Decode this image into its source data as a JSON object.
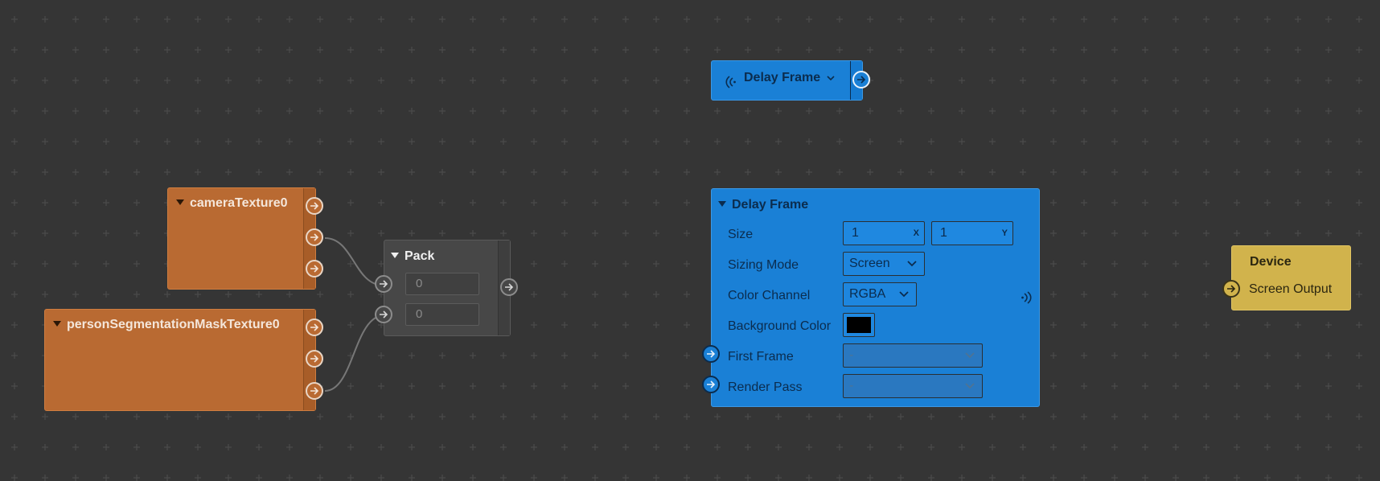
{
  "nodes": {
    "camera_texture": {
      "title": "cameraTexture0"
    },
    "person_mask": {
      "title": "personSegmentationMaskTexture0"
    },
    "pack": {
      "title": "Pack",
      "field_1": "0",
      "field_2": "0"
    },
    "delay_collapsed": {
      "title": "Delay Frame"
    },
    "delay_frame": {
      "title": "Delay Frame",
      "size_label": "Size",
      "size_x": "1",
      "size_x_axis": "X",
      "size_y": "1",
      "size_y_axis": "Y",
      "sizing_mode_label": "Sizing Mode",
      "sizing_mode_value": "Screen",
      "color_channel_label": "Color Channel",
      "color_channel_value": "RGBA",
      "background_color_label": "Background Color",
      "background_color_value": "#000000",
      "first_frame_label": "First Frame",
      "first_frame_value": "-",
      "render_pass_label": "Render Pass",
      "render_pass_value": "-"
    },
    "device": {
      "title": "Device",
      "output_label": "Screen Output"
    }
  },
  "colors": {
    "canvas": "#353535",
    "texture_node": "#b96a32",
    "pack_node": "#474747",
    "delay_node": "#1a80d6",
    "device_node": "#d1b34c"
  },
  "icons": {
    "port": "arrow-right-icon",
    "signal": "signal-waves-icon",
    "dropdown": "chevron-down-icon",
    "collapse": "triangle-down-icon"
  }
}
